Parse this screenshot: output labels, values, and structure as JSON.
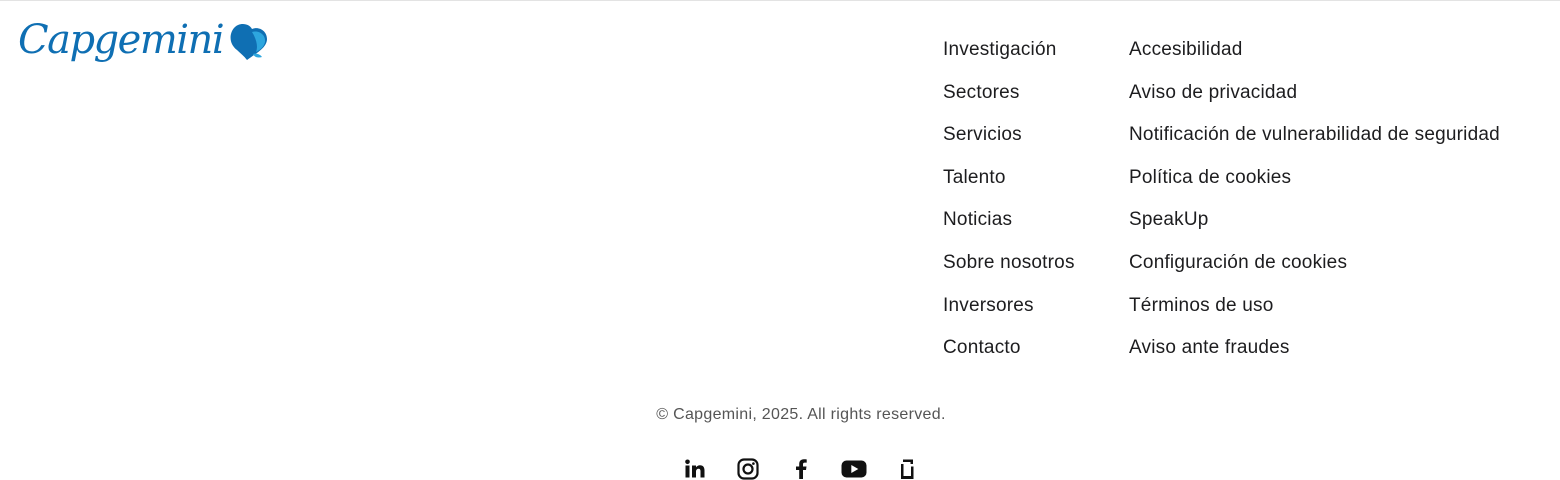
{
  "logo": {
    "text": "Capgemini",
    "brand_color": "#0f6fb3",
    "accent_color": "#2da6de"
  },
  "footer": {
    "nav_col_1": [
      {
        "label": "Investigación"
      },
      {
        "label": "Sectores"
      },
      {
        "label": "Servicios"
      },
      {
        "label": "Talento"
      },
      {
        "label": "Noticias"
      },
      {
        "label": "Sobre nosotros"
      },
      {
        "label": "Inversores"
      },
      {
        "label": "Contacto"
      }
    ],
    "nav_col_2": [
      {
        "label": "Accesibilidad"
      },
      {
        "label": "Aviso de privacidad"
      },
      {
        "label": "Notificación de vulnerabilidad de seguridad"
      },
      {
        "label": "Política de cookies"
      },
      {
        "label": "SpeakUp"
      },
      {
        "label": "Configuración de cookies"
      },
      {
        "label": "Términos de uso"
      },
      {
        "label": "Aviso ante fraudes"
      }
    ],
    "copyright": "© Capgemini, 2025. All rights reserved.",
    "social": [
      {
        "icon": "linkedin-icon"
      },
      {
        "icon": "instagram-icon"
      },
      {
        "icon": "facebook-icon"
      },
      {
        "icon": "youtube-icon"
      },
      {
        "icon": "glassdoor-icon"
      }
    ]
  }
}
